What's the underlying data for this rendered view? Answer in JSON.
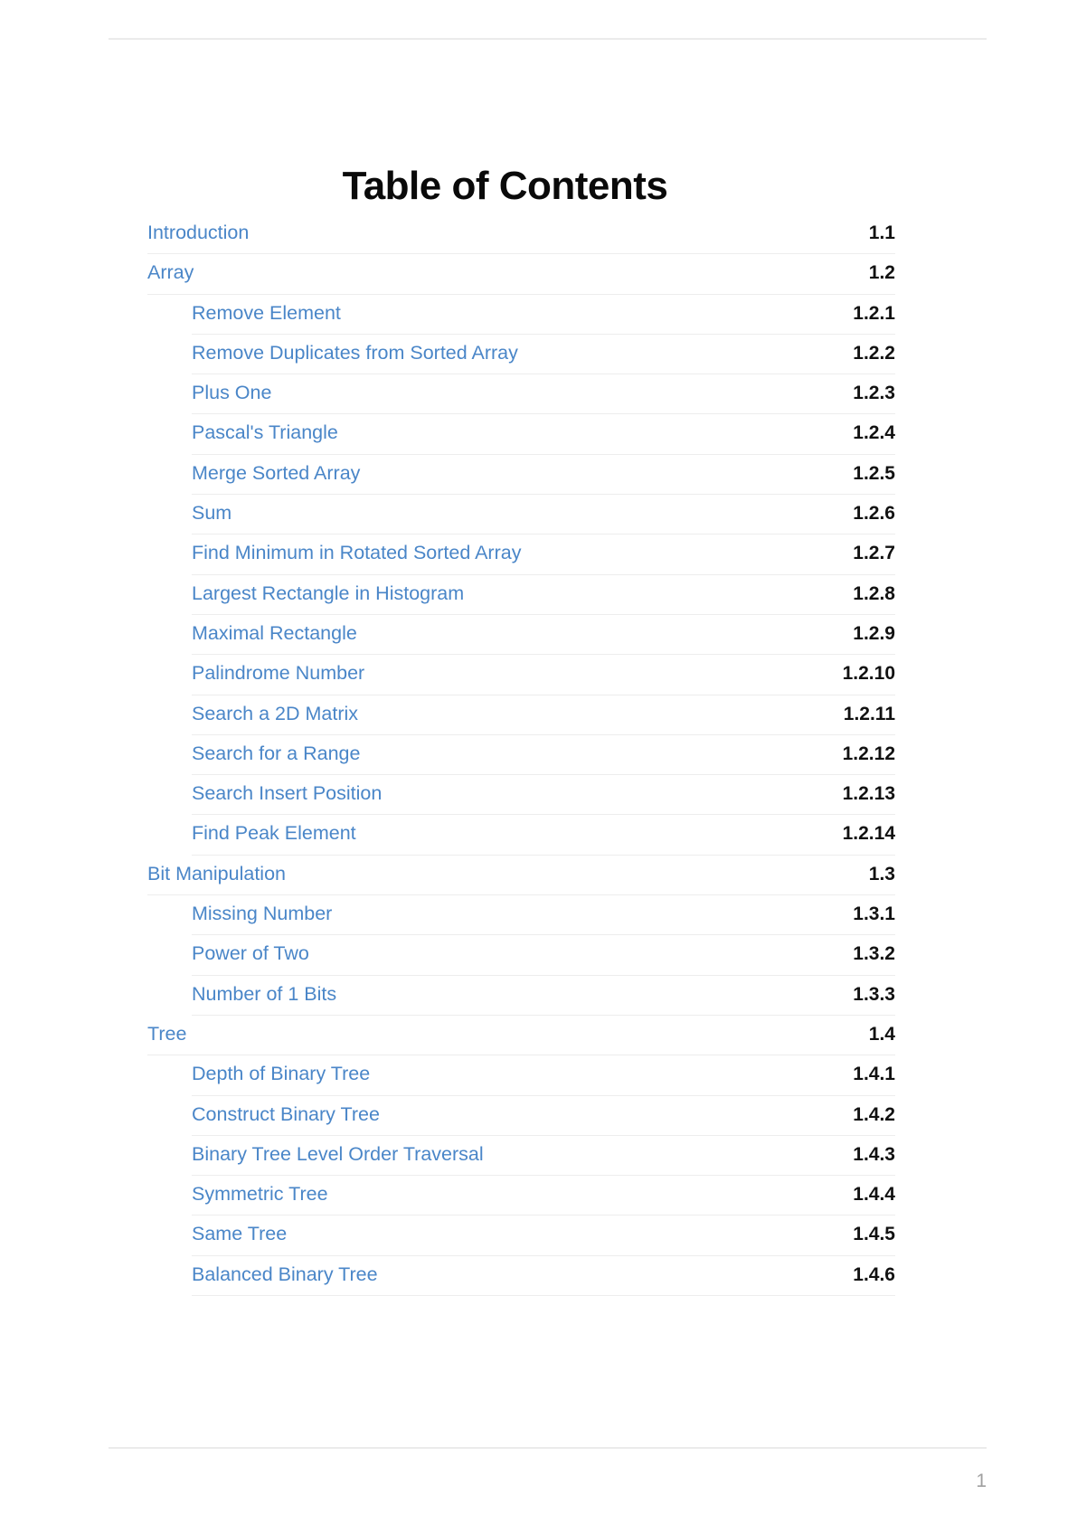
{
  "document": {
    "title": "Table of Contents",
    "page_number": "1"
  },
  "colors": {
    "link": "#4a86c8",
    "number": "#111111",
    "divider": "#ededed",
    "rule": "#ebebeb",
    "page_number": "#a0a0a0"
  },
  "toc": {
    "entries": [
      {
        "label": "Introduction",
        "number": "1.1",
        "level": 1
      },
      {
        "label": "Array",
        "number": "1.2",
        "level": 1
      },
      {
        "label": "Remove Element",
        "number": "1.2.1",
        "level": 2
      },
      {
        "label": "Remove Duplicates from Sorted Array",
        "number": "1.2.2",
        "level": 2
      },
      {
        "label": "Plus One",
        "number": "1.2.3",
        "level": 2
      },
      {
        "label": "Pascal's Triangle",
        "number": "1.2.4",
        "level": 2
      },
      {
        "label": "Merge Sorted Array",
        "number": "1.2.5",
        "level": 2
      },
      {
        "label": "Sum",
        "number": "1.2.6",
        "level": 2
      },
      {
        "label": "Find Minimum in Rotated Sorted Array",
        "number": "1.2.7",
        "level": 2
      },
      {
        "label": "Largest Rectangle in Histogram",
        "number": "1.2.8",
        "level": 2
      },
      {
        "label": "Maximal Rectangle",
        "number": "1.2.9",
        "level": 2
      },
      {
        "label": "Palindrome Number",
        "number": "1.2.10",
        "level": 2
      },
      {
        "label": "Search a 2D Matrix",
        "number": "1.2.11",
        "level": 2
      },
      {
        "label": "Search for a Range",
        "number": "1.2.12",
        "level": 2
      },
      {
        "label": "Search Insert Position",
        "number": "1.2.13",
        "level": 2
      },
      {
        "label": "Find Peak Element",
        "number": "1.2.14",
        "level": 2
      },
      {
        "label": "Bit Manipulation",
        "number": "1.3",
        "level": 1
      },
      {
        "label": "Missing Number",
        "number": "1.3.1",
        "level": 2
      },
      {
        "label": "Power of Two",
        "number": "1.3.2",
        "level": 2
      },
      {
        "label": "Number of 1 Bits",
        "number": "1.3.3",
        "level": 2
      },
      {
        "label": "Tree",
        "number": "1.4",
        "level": 1
      },
      {
        "label": "Depth of Binary Tree",
        "number": "1.4.1",
        "level": 2
      },
      {
        "label": "Construct Binary Tree",
        "number": "1.4.2",
        "level": 2
      },
      {
        "label": "Binary Tree Level Order Traversal",
        "number": "1.4.3",
        "level": 2
      },
      {
        "label": "Symmetric Tree",
        "number": "1.4.4",
        "level": 2
      },
      {
        "label": "Same Tree",
        "number": "1.4.5",
        "level": 2
      },
      {
        "label": "Balanced Binary Tree",
        "number": "1.4.6",
        "level": 2
      }
    ]
  }
}
